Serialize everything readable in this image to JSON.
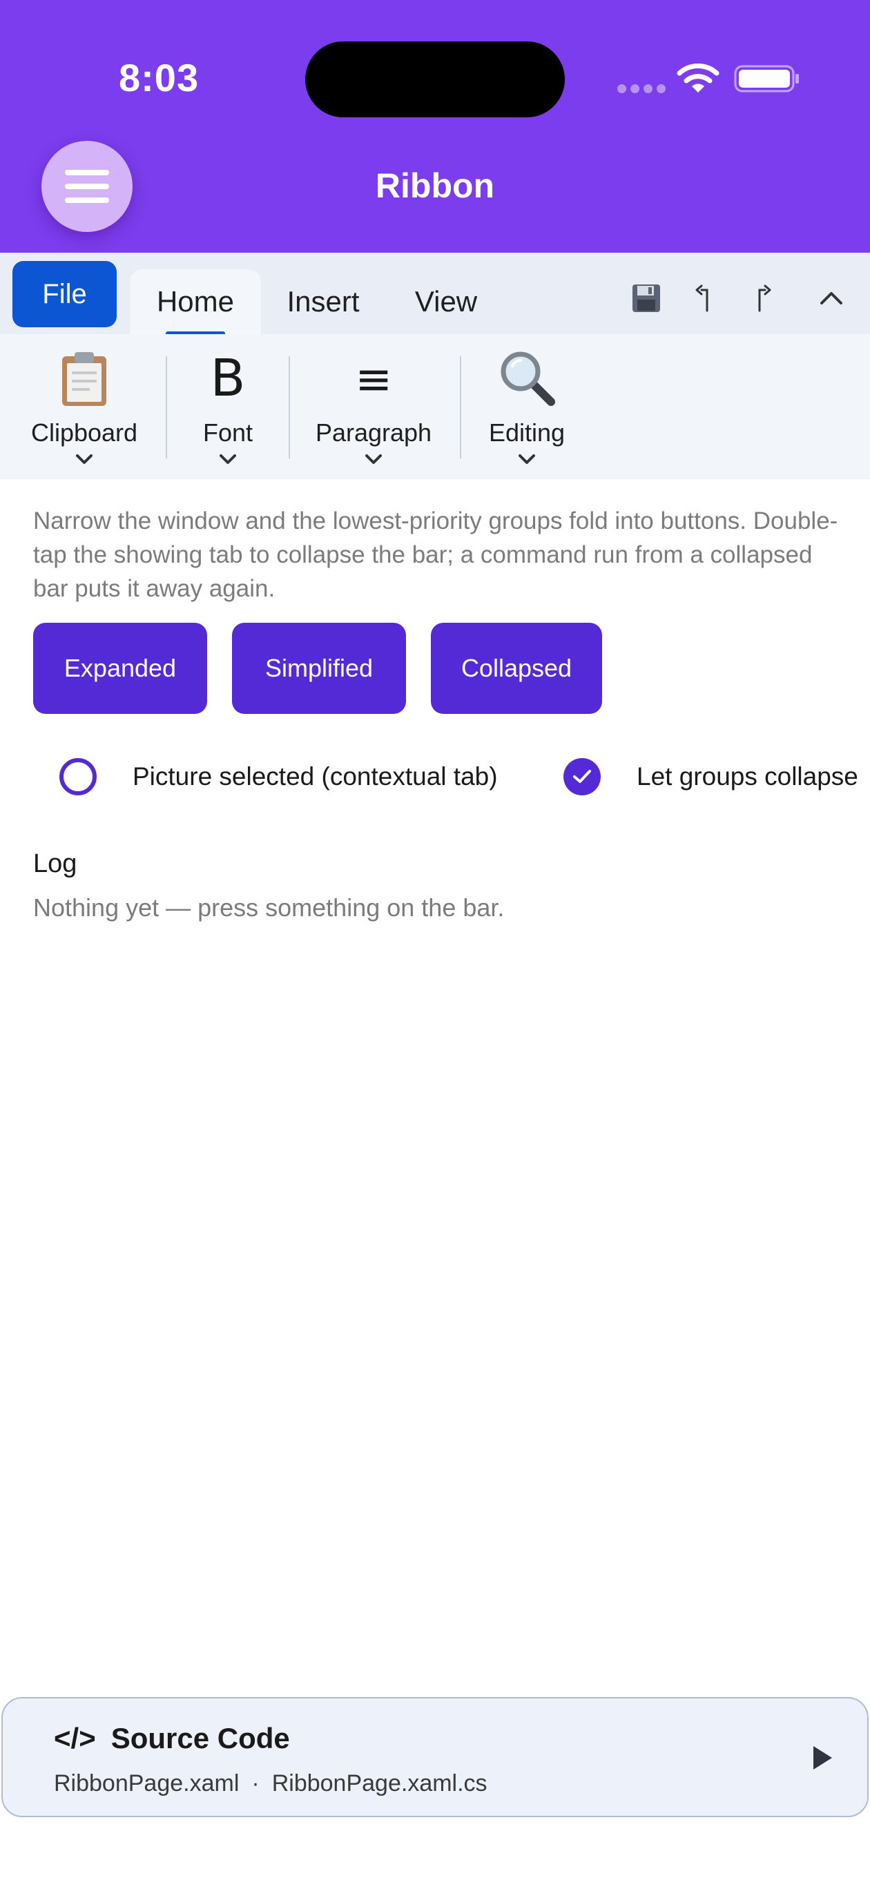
{
  "status_bar": {
    "time": "8:03"
  },
  "app_bar": {
    "title": "Ribbon"
  },
  "ribbon": {
    "file_label": "File",
    "tabs": [
      {
        "label": "Home",
        "selected": true
      },
      {
        "label": "Insert",
        "selected": false
      },
      {
        "label": "View",
        "selected": false
      }
    ],
    "quick_access": [
      "save-icon",
      "undo-icon",
      "redo-icon",
      "collapse-ribbon-icon"
    ],
    "groups": [
      {
        "label": "Clipboard",
        "icon": "clipboard-icon"
      },
      {
        "label": "Font",
        "icon": "bold-icon",
        "icon_glyph": "B"
      },
      {
        "label": "Paragraph",
        "icon": "align-icon",
        "icon_glyph": "≡"
      },
      {
        "label": "Editing",
        "icon": "magnifier-icon"
      }
    ]
  },
  "help_text": "Narrow the window and the lowest-priority groups fold into buttons. Double-tap the showing tab to collapse the bar; a command run from a collapsed bar puts it away again.",
  "mode_buttons": [
    "Expanded",
    "Simplified",
    "Collapsed"
  ],
  "options": {
    "contextual": {
      "label": "Picture selected (contextual tab)",
      "checked": false
    },
    "collapse": {
      "label": "Let groups collapse",
      "checked": true
    }
  },
  "log": {
    "title": "Log",
    "empty_text": "Nothing yet — press something on the bar."
  },
  "source_code": {
    "glyph": "</>",
    "title": "Source Code",
    "file1": "RibbonPage.xaml",
    "separator": "·",
    "file2": "RibbonPage.xaml.cs"
  },
  "colors": {
    "header": "#7b3ded",
    "accent": "#5429d6",
    "file_button": "#0c56d3",
    "ribbon_bg": "#eef2f9"
  }
}
